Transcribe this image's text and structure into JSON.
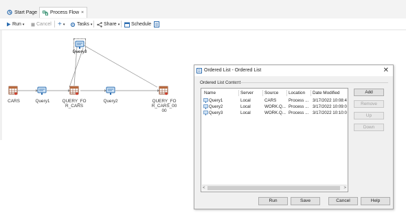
{
  "tabs": [
    {
      "label": "Start Page"
    },
    {
      "label": "Process Flow",
      "close": "×"
    }
  ],
  "toolbar": {
    "run": "Run",
    "cancel": "Cancel",
    "tasks": "Tasks",
    "share": "Share",
    "schedule": "Schedule"
  },
  "flow": {
    "nodes": [
      {
        "label": "CARS"
      },
      {
        "label": "Query1"
      },
      {
        "label_line1": "QUERY_FO",
        "label_line2": "R_CARS"
      },
      {
        "label": "Query2"
      },
      {
        "label_line1": "QUERY_FO",
        "label_line2": "R_CARS_00",
        "label_line3": "00"
      },
      {
        "label": "Query3"
      }
    ]
  },
  "dialog": {
    "title": "Ordered List - Ordered List",
    "close": "✕",
    "group_label": "Ordered List Content",
    "columns": [
      "Name",
      "Server",
      "Source",
      "Location",
      "Date Modified"
    ],
    "rows": [
      {
        "name": "Query1",
        "server": "Local",
        "source": "CARS",
        "location": "Process ...",
        "date": "3/17/2022 10:08:4..."
      },
      {
        "name": "Query2",
        "server": "Local",
        "source": "WORK.Q...",
        "location": "Process ...",
        "date": "3/17/2022 10:09:0..."
      },
      {
        "name": "Query3",
        "server": "Local",
        "source": "WORK.Q...",
        "location": "Process ...",
        "date": "3/17/2022 10:10:0..."
      }
    ],
    "side_buttons": {
      "add": "Add",
      "remove": "Remove",
      "up": "Up",
      "down": "Down"
    },
    "buttons": {
      "run": "Run",
      "save": "Save",
      "cancel": "Cancel",
      "help": "Help"
    }
  },
  "colors": {
    "accent": "#2b6cb0",
    "dialog_bg": "#f0f0f0",
    "link_line": "#888888"
  }
}
